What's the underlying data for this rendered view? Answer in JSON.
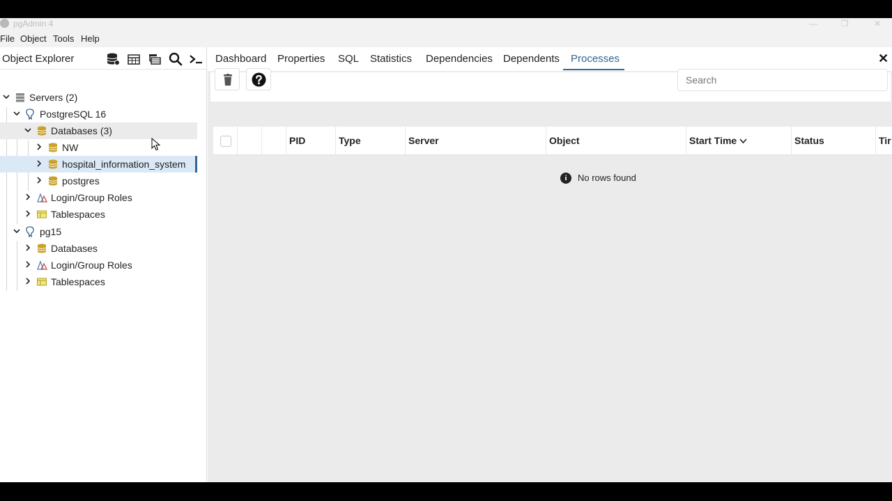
{
  "window": {
    "title": "pgAdmin 4",
    "minimize": "—",
    "maximize": "❐",
    "close": "✕"
  },
  "menu": [
    "File",
    "Object",
    "Tools",
    "Help"
  ],
  "object_explorer": {
    "title": "Object Explorer",
    "toolbar_icons": [
      "database-icon",
      "table-icon",
      "query-tool-icon",
      "search-icon",
      "terminal-icon"
    ],
    "tree": [
      {
        "label": "Servers (2)",
        "icon": "servers-icon"
      },
      {
        "label": "PostgreSQL 16",
        "icon": "elephant-icon"
      },
      {
        "label": "Databases (3)",
        "icon": "database-icon"
      },
      {
        "label": "NW",
        "icon": "database-icon"
      },
      {
        "label": "hospital_information_system",
        "icon": "database-icon"
      },
      {
        "label": "postgres",
        "icon": "database-icon"
      },
      {
        "label": "Login/Group Roles",
        "icon": "roles-icon"
      },
      {
        "label": "Tablespaces",
        "icon": "tablespace-icon"
      },
      {
        "label": "pg15",
        "icon": "elephant-icon"
      },
      {
        "label": "Databases",
        "icon": "database-icon"
      },
      {
        "label": "Login/Group Roles",
        "icon": "roles-icon"
      },
      {
        "label": "Tablespaces",
        "icon": "tablespace-icon"
      }
    ]
  },
  "tabs": [
    "Dashboard",
    "Properties",
    "SQL",
    "Statistics",
    "Dependencies",
    "Dependents",
    "Processes"
  ],
  "active_tab": "Processes",
  "processes": {
    "search_placeholder": "Search",
    "columns": [
      "PID",
      "Type",
      "Server",
      "Object",
      "Start Time",
      "Status",
      "Tir"
    ],
    "sort_indicator": "⌄",
    "empty_message": "No rows found",
    "info_glyph": "i"
  },
  "colors": {
    "accent": "#326690",
    "db_icon": "#c9a227",
    "selection": "#dbe9f7"
  }
}
